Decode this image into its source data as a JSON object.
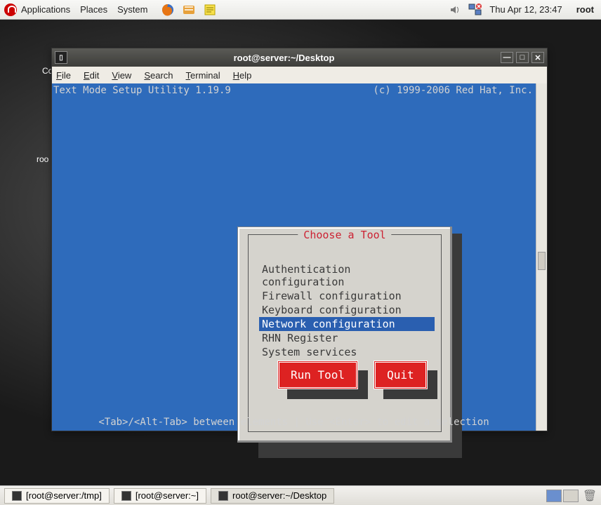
{
  "panel": {
    "menus": [
      "Applications",
      "Places",
      "System"
    ],
    "clock": "Thu Apr 12, 23:47",
    "user": "root"
  },
  "desktop": {
    "icon_label_1": "Co",
    "icon_label_2": "roo"
  },
  "window": {
    "title": "root@server:~/Desktop",
    "menus": {
      "file": "File",
      "edit": "Edit",
      "view": "View",
      "search": "Search",
      "terminal": "Terminal",
      "help": "Help"
    }
  },
  "tui": {
    "header_left": "Text Mode Setup Utility 1.19.9",
    "header_right": "(c) 1999-2006 Red Hat, Inc.",
    "dialog_title": "Choose a Tool",
    "tools": [
      "Authentication configuration",
      "Firewall configuration",
      "Keyboard configuration",
      "Network configuration",
      "RHN Register",
      "System services"
    ],
    "selected_index": 3,
    "run_label": "Run Tool",
    "quit_label": "Quit",
    "footer": "<Tab>/<Alt-Tab> between elements   |   Use <Enter> to edit a selection"
  },
  "taskbar": {
    "tasks": [
      "[root@server:/tmp]",
      "[root@server:~]",
      "root@server:~/Desktop"
    ],
    "active_index": 2
  }
}
